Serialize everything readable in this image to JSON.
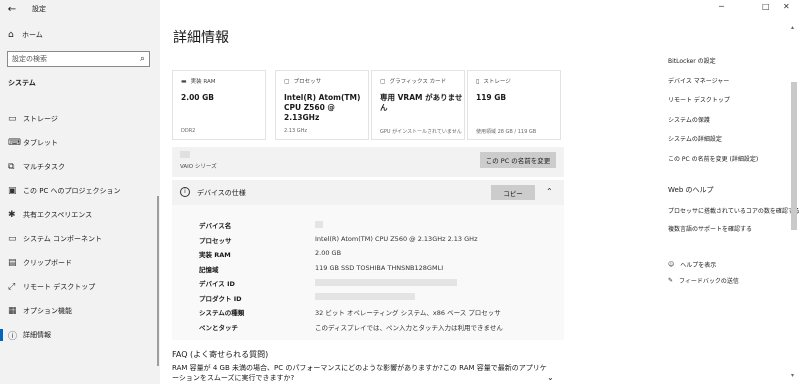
{
  "window": {
    "app_title": "設定",
    "minimize": "─",
    "maximize": "□",
    "close": "✕"
  },
  "sidebar": {
    "home_label": "ホーム",
    "search_placeholder": "設定の検索",
    "section_title": "システム",
    "items": [
      {
        "label": "ストレージ",
        "icon": "storage-icon",
        "glyph": "▭"
      },
      {
        "label": "タブレット",
        "icon": "tablet-icon",
        "glyph": "⌨"
      },
      {
        "label": "マルチタスク",
        "icon": "multitask-icon",
        "glyph": "⧉"
      },
      {
        "label": "この PC へのプロジェクション",
        "icon": "projection-icon",
        "glyph": "▣"
      },
      {
        "label": "共有エクスペリエンス",
        "icon": "share-icon",
        "glyph": "✱"
      },
      {
        "label": "システム コンポーネント",
        "icon": "components-icon",
        "glyph": "▭"
      },
      {
        "label": "クリップボード",
        "icon": "clipboard-icon",
        "glyph": "▤"
      },
      {
        "label": "リモート デスクトップ",
        "icon": "remote-icon",
        "glyph": "⤢"
      },
      {
        "label": "オプション機能",
        "icon": "optional-features-icon",
        "glyph": "▦"
      },
      {
        "label": "詳細情報",
        "icon": "info-icon",
        "glyph": "ⓘ"
      }
    ]
  },
  "main": {
    "title": "詳細情報",
    "cards": [
      {
        "head": "実装 RAM",
        "icon": "ram-icon",
        "glyph": "▬",
        "value": "2.00 GB",
        "sub": "DDR2"
      },
      {
        "head": "プロセッサ",
        "icon": "processor-icon",
        "glyph": "▢",
        "value": "Intel(R) Atom(TM) CPU Z560 @ 2.13GHz",
        "sub": "2.13 GHz"
      },
      {
        "head": "グラフィックス カード",
        "icon": "graphics-icon",
        "glyph": "▢",
        "value": "専用 VRAM がありません",
        "sub": "GPU がインストールされていません"
      },
      {
        "head": "ストレージ",
        "icon": "storage-card-icon",
        "glyph": "▯",
        "value": "119 GB",
        "sub": "使用領域 28 GB / 119 GB"
      }
    ],
    "series": "VAIO シリーズ",
    "rename_button": "この PC の名前を変更",
    "spec_header": "デバイスの仕様",
    "copy_button": "コピー",
    "specs": [
      {
        "key": "デバイス名",
        "value": ""
      },
      {
        "key": "プロセッサ",
        "value": "Intel(R) Atom(TM) CPU Z560 @ 2.13GHz 2.13 GHz"
      },
      {
        "key": "実装 RAM",
        "value": "2.00 GB"
      },
      {
        "key": "記憶域",
        "value": "119 GB SSD TOSHIBA THNSNB128GMLI"
      },
      {
        "key": "デバイス ID",
        "value": ""
      },
      {
        "key": "プロダクト ID",
        "value": ""
      },
      {
        "key": "システムの種類",
        "value": "32 ビット オペレーティング システム、x86 ベース プロセッサ"
      },
      {
        "key": "ペンとタッチ",
        "value": "このディスプレイでは、ペン入力とタッチ入力は利用できません"
      }
    ],
    "faq_title": "FAQ (よく寄せられる質問)",
    "faq_question": "RAM 容量が 4 GB 未満の場合、PC のパフォーマンスにどのような影響がありますか?この RAM 容量で最新のアプリケーションをスムーズに実行できますか?"
  },
  "right": {
    "links": [
      "BitLocker の設定",
      "デバイス マネージャー",
      "リモート デスクトップ",
      "システムの保護",
      "システムの詳細設定",
      "この PC の名前を変更 (詳細設定)"
    ],
    "web_help_title": "Web のヘルプ",
    "web_links": [
      "プロセッサに搭載されているコアの数を確認する",
      "複数言語のサポートを確認する"
    ],
    "help_label": "ヘルプを表示",
    "feedback_label": "フィードバックの送信"
  }
}
